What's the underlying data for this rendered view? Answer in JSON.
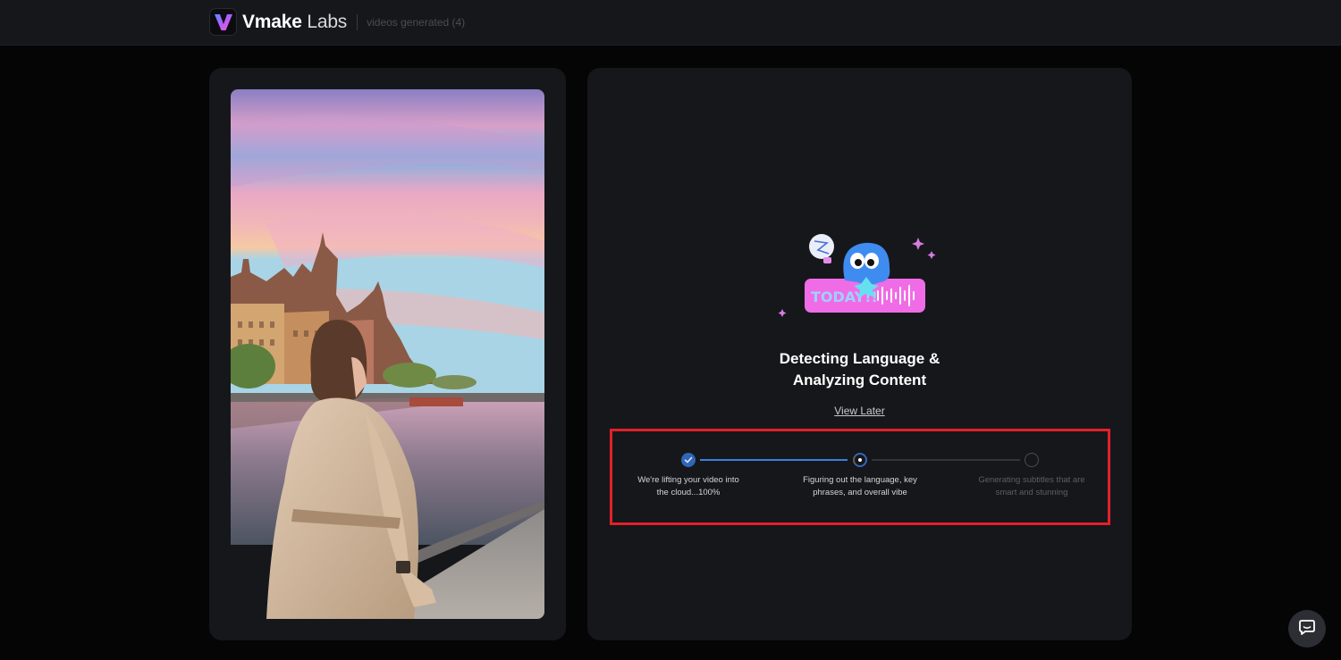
{
  "header": {
    "brand_bold": "Vmake",
    "brand_light": "Labs",
    "videos_generated": "videos generated (4)",
    "logo_icon": "vmake-v-logo-icon"
  },
  "preview": {
    "description_icon": "video-thumbnail"
  },
  "status": {
    "title_line1": "Detecting Language &",
    "title_line2": "Analyzing Content",
    "view_later": "View Later",
    "illustration_badge": "TODAY"
  },
  "steps": [
    {
      "label_line1": "We're lifting your video into",
      "label_line2": "the cloud...100%",
      "state": "done"
    },
    {
      "label_line1": "Figuring out the language, key",
      "label_line2": "phrases, and overall vibe",
      "state": "active"
    },
    {
      "label_line1": "Generating subtitles that are",
      "label_line2": "smart and stunning",
      "state": "pending"
    }
  ],
  "colors": {
    "accent": "#3b7de0",
    "highlight_border": "#e2202a",
    "panel": "#16171b",
    "background": "#050505"
  },
  "chat": {
    "icon": "chat-bubble-icon"
  }
}
